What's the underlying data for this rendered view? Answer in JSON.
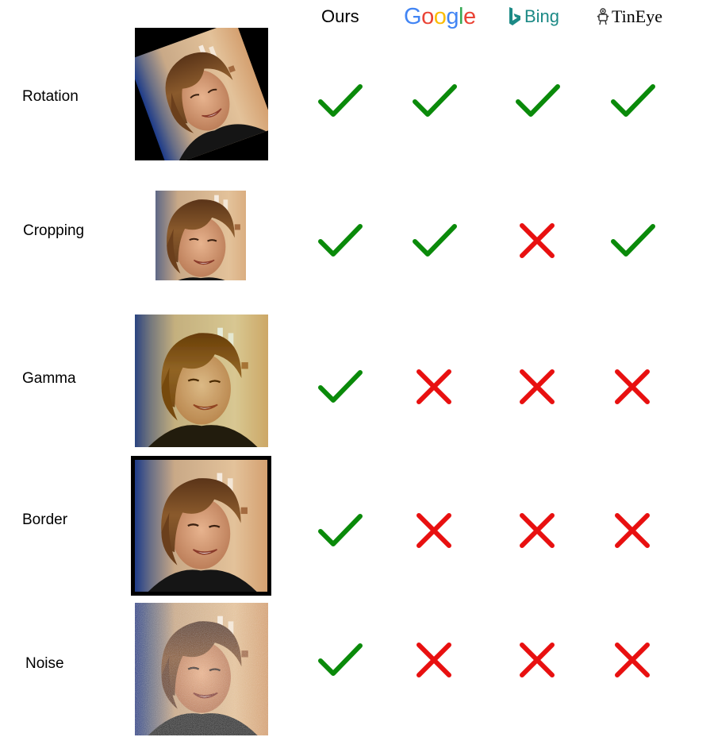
{
  "header": {
    "ours": "Ours",
    "google": [
      "G",
      "o",
      "o",
      "g",
      "l",
      "e"
    ],
    "google_colors": [
      "#4285F4",
      "#EA4335",
      "#FBBC05",
      "#4285F4",
      "#34A853",
      "#EA4335"
    ],
    "bing": "Bing",
    "bing_icon": "bing-logo-icon",
    "tineye": "TinEye",
    "tineye_icon": "tineye-robot-icon"
  },
  "rows": [
    {
      "label": "Rotation",
      "variant": "rotation",
      "results": [
        "check",
        "check",
        "check",
        "check"
      ]
    },
    {
      "label": "Cropping",
      "variant": "cropping",
      "results": [
        "check",
        "check",
        "cross",
        "check"
      ]
    },
    {
      "label": "Gamma",
      "variant": "gamma",
      "results": [
        "check",
        "cross",
        "cross",
        "cross"
      ]
    },
    {
      "label": "Border",
      "variant": "border",
      "results": [
        "check",
        "cross",
        "cross",
        "cross"
      ]
    },
    {
      "label": "Noise",
      "variant": "noise",
      "results": [
        "check",
        "cross",
        "cross",
        "cross"
      ]
    }
  ],
  "colors": {
    "check": "#0a8a0a",
    "cross": "#e81010"
  },
  "icons": {
    "check": "check-icon",
    "cross": "cross-icon",
    "image": "portrait-thumbnail"
  }
}
